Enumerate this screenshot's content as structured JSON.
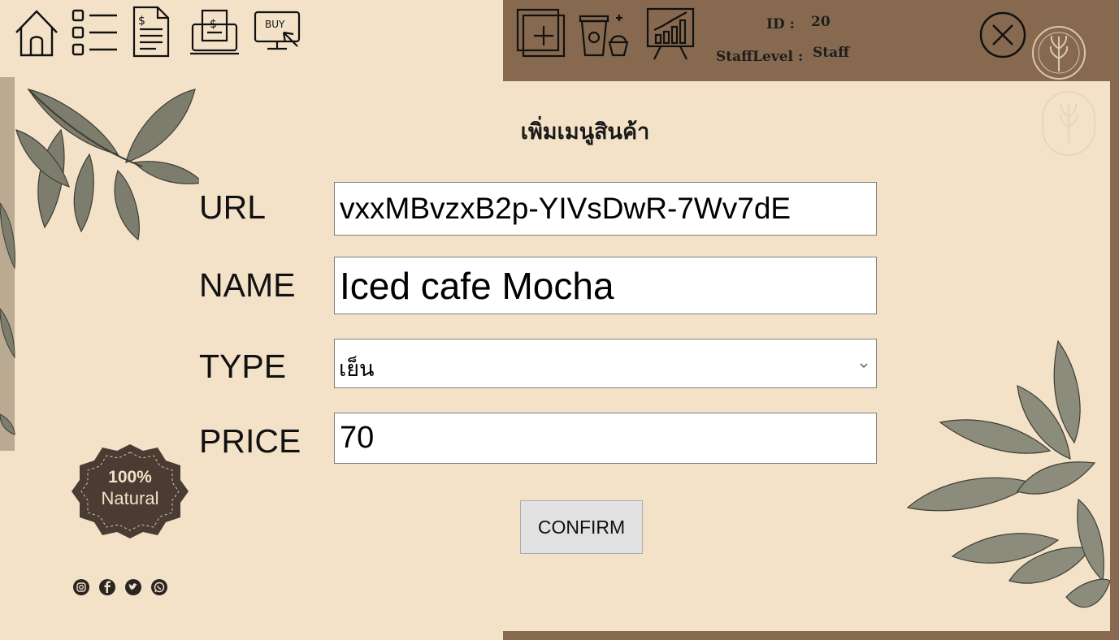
{
  "header": {
    "id_label": "ID :",
    "id_value": "20",
    "staff_level_label": "StaffLevel :",
    "staff_level_value": "Staff",
    "buy_icon_text": "BUY"
  },
  "form": {
    "title": "เพิ่มเมนูสินค้า",
    "url_label": "URL",
    "url_value": "vxxMBvzxB2p-YIVsDwR-7Wv7dE",
    "name_label": "NAME",
    "name_value": "Iced cafe Mocha",
    "type_label": "TYPE",
    "type_value": "เย็น",
    "price_label": "PRICE",
    "price_value": "70",
    "confirm_label": "CONFIRM"
  },
  "badge": {
    "line1": "100%",
    "line2": "Natural"
  },
  "icons": {
    "nav": [
      "home-icon",
      "list-icon",
      "document-icon",
      "receipt-icon",
      "buy-icon"
    ],
    "tools": [
      "add-icon",
      "coffee-cake-icon",
      "chart-icon"
    ],
    "social": [
      "instagram-icon",
      "facebook-icon",
      "twitter-icon",
      "whatsapp-icon"
    ],
    "close": "close-icon"
  },
  "colors": {
    "background": "#f3e2c7",
    "brown": "#86694f",
    "badge": "#4a3b33",
    "leaf": "#7c7d6c"
  }
}
